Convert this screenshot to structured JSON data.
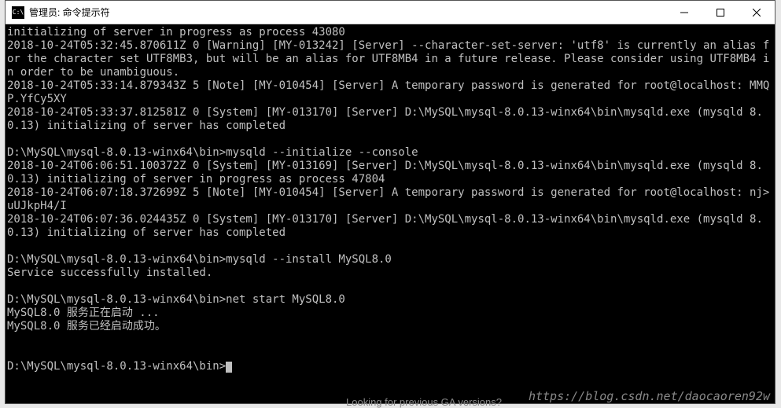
{
  "window": {
    "icon_text": "C:\\",
    "title": "管理员: 命令提示符"
  },
  "console": {
    "lines": [
      "initializing of server in progress as process 43080",
      "2018-10-24T05:32:45.870611Z 0 [Warning] [MY-013242] [Server] --character-set-server: 'utf8' is currently an alias for the character set UTF8MB3, but will be an alias for UTF8MB4 in a future release. Please consider using UTF8MB4 in order to be unambiguous.",
      "2018-10-24T05:33:14.879343Z 5 [Note] [MY-010454] [Server] A temporary password is generated for root@localhost: MMQP.YfCy5XY",
      "2018-10-24T05:33:37.812581Z 0 [System] [MY-013170] [Server] D:\\MySQL\\mysql-8.0.13-winx64\\bin\\mysqld.exe (mysqld 8.0.13) initializing of server has completed",
      "",
      "D:\\MySQL\\mysql-8.0.13-winx64\\bin>mysqld --initialize --console",
      "2018-10-24T06:06:51.100372Z 0 [System] [MY-013169] [Server] D:\\MySQL\\mysql-8.0.13-winx64\\bin\\mysqld.exe (mysqld 8.0.13) initializing of server in progress as process 47804",
      "2018-10-24T06:07:18.372699Z 5 [Note] [MY-010454] [Server] A temporary password is generated for root@localhost: nj>uUJkpH4/I",
      "2018-10-24T06:07:36.024435Z 0 [System] [MY-013170] [Server] D:\\MySQL\\mysql-8.0.13-winx64\\bin\\mysqld.exe (mysqld 8.0.13) initializing of server has completed",
      "",
      "D:\\MySQL\\mysql-8.0.13-winx64\\bin>mysqld --install MySQL8.0",
      "Service successfully installed.",
      "",
      "D:\\MySQL\\mysql-8.0.13-winx64\\bin>net start MySQL8.0",
      "MySQL8.0 服务正在启动 ...",
      "MySQL8.0 服务已经启动成功。",
      "",
      "",
      "D:\\MySQL\\mysql-8.0.13-winx64\\bin>"
    ]
  },
  "watermark": "https://blog.csdn.net/daocaoren92w",
  "bg_text": "Looking for previous GA versions?"
}
